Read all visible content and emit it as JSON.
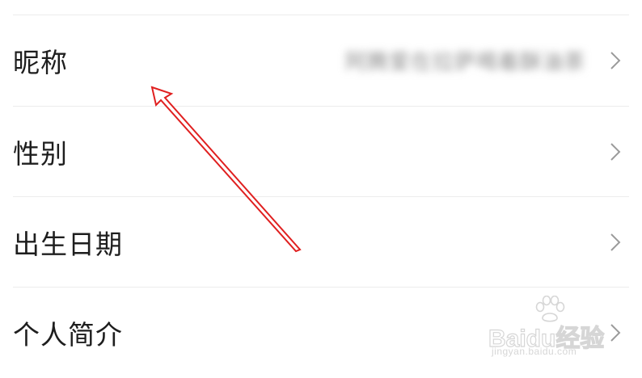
{
  "rows": [
    {
      "label": "昵称",
      "value": "阿腾爱在拉萨喝着酥油茶",
      "chevron": "chevron-right-icon"
    },
    {
      "label": "性别",
      "value": "",
      "chevron": "chevron-right-icon"
    },
    {
      "label": "出生日期",
      "value": "",
      "chevron": "chevron-right-icon"
    },
    {
      "label": "个人简介",
      "value": "",
      "chevron": "chevron-right-icon"
    }
  ],
  "watermark": {
    "brand": "Baidu经验",
    "url": "jingyan.baidu.com"
  },
  "colors": {
    "annotation_arrow": "#e02020",
    "label_text": "#1e1e1e",
    "divider": "#ececec",
    "chevron": "#9a9a9a"
  }
}
